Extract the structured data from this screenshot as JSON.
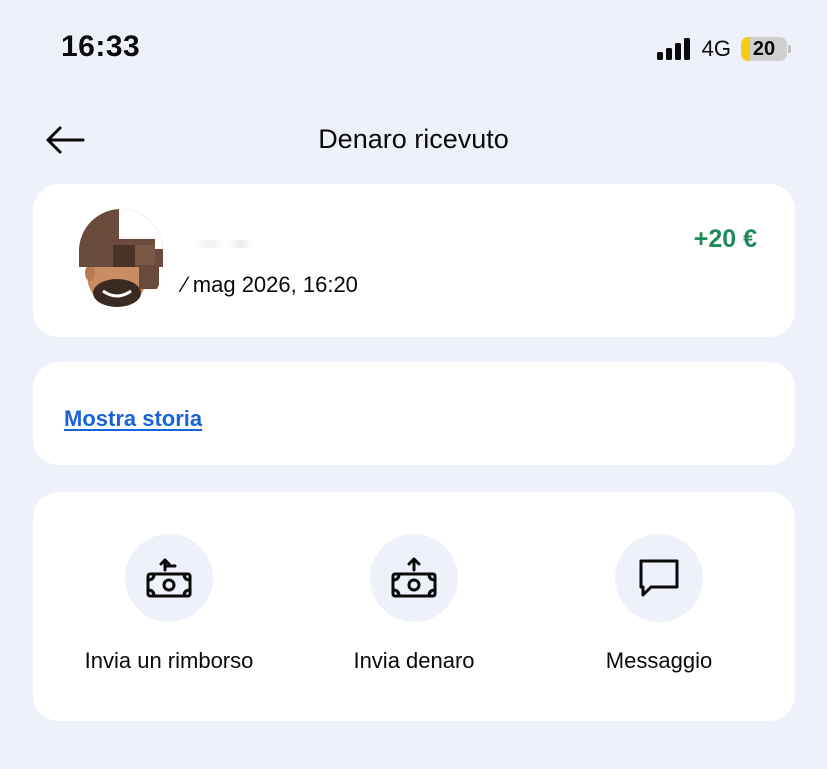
{
  "status_bar": {
    "time": "16:33",
    "network": "4G",
    "battery": "20"
  },
  "header": {
    "title": "Denaro ricevuto",
    "back_icon": "arrow-left-icon"
  },
  "transaction": {
    "counterparty_name": "",
    "date": "⁄ mag 2026, 16:20",
    "amount": "+20 €",
    "amount_color": "#1f8a5b"
  },
  "history": {
    "link_label": "Mostra storia",
    "link_color": "#1a63d6"
  },
  "actions": [
    {
      "label": "Invia un rimborso",
      "icon": "send-refund-icon"
    },
    {
      "label": "Invia denaro",
      "icon": "send-money-icon"
    },
    {
      "label": "Messaggio",
      "icon": "message-icon"
    }
  ]
}
